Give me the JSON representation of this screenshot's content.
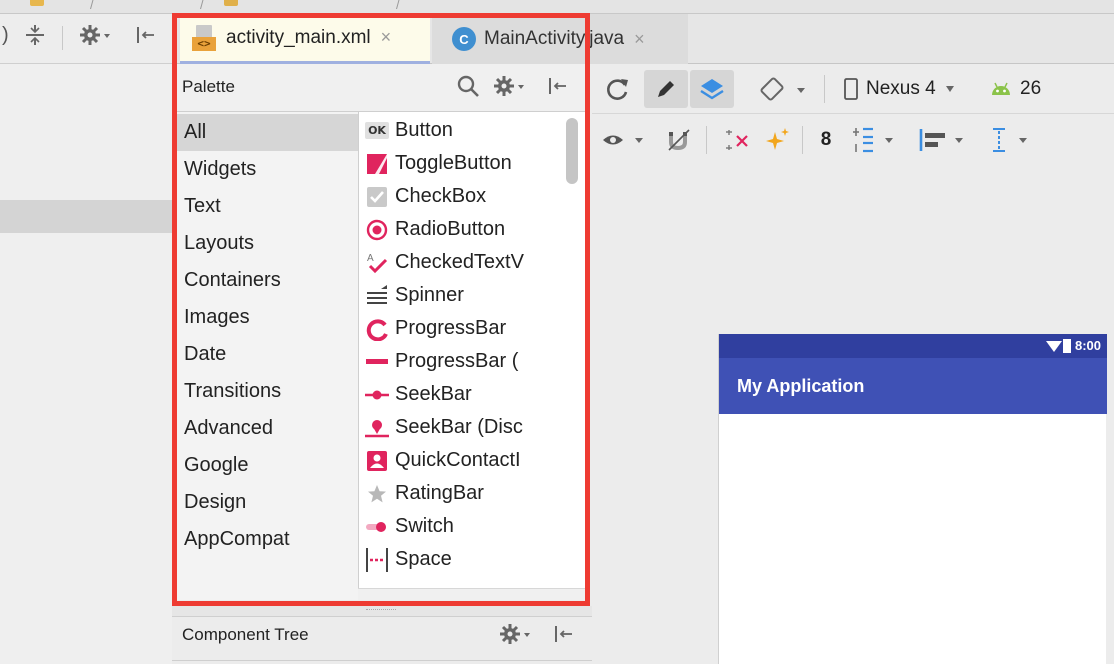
{
  "editor_tabs": [
    {
      "label": "activity_main.xml",
      "icon": "xml-layout-file-icon",
      "active": true
    },
    {
      "label": "MainActivity.java",
      "icon": "java-class-icon",
      "active": false
    }
  ],
  "xml_icon_text": "<>",
  "java_icon_text": "C",
  "close_glyph": "×",
  "palette": {
    "title": "Palette",
    "categories": [
      "All",
      "Widgets",
      "Text",
      "Layouts",
      "Containers",
      "Images",
      "Date",
      "Transitions",
      "Advanced",
      "Google",
      "Design",
      "AppCompat"
    ],
    "selected_category": "All",
    "components": [
      {
        "label": "Button",
        "icon": "ok-button-icon"
      },
      {
        "label": "ToggleButton",
        "icon": "toggle-button-icon"
      },
      {
        "label": "CheckBox",
        "icon": "checkbox-icon"
      },
      {
        "label": "RadioButton",
        "icon": "radio-button-icon"
      },
      {
        "label": "CheckedTextV",
        "icon": "checked-text-view-icon"
      },
      {
        "label": "Spinner",
        "icon": "spinner-icon"
      },
      {
        "label": "ProgressBar",
        "icon": "progress-circle-icon"
      },
      {
        "label": "ProgressBar (",
        "icon": "progress-horizontal-icon"
      },
      {
        "label": "SeekBar",
        "icon": "seekbar-icon"
      },
      {
        "label": "SeekBar (Disc",
        "icon": "seekbar-discrete-icon"
      },
      {
        "label": "QuickContactI",
        "icon": "quick-contact-icon"
      },
      {
        "label": "RatingBar",
        "icon": "star-icon"
      },
      {
        "label": "Switch",
        "icon": "switch-icon"
      },
      {
        "label": "Space",
        "icon": "space-icon"
      }
    ]
  },
  "ok_icon_text": "OK",
  "component_tree": {
    "title": "Component Tree"
  },
  "device": {
    "name": "Nexus 4",
    "api": "26"
  },
  "toolbar2": {
    "default_margin": "8"
  },
  "preview": {
    "app_title": "My Application",
    "time": "8:00"
  },
  "colors": {
    "highlight": "#ee3b32",
    "accent_pink": "#e0245e",
    "app_bar": "#3f51b5",
    "status_bar": "#303f9f",
    "design_blue": "#3b8ee2",
    "android_green": "#8bc34a"
  }
}
